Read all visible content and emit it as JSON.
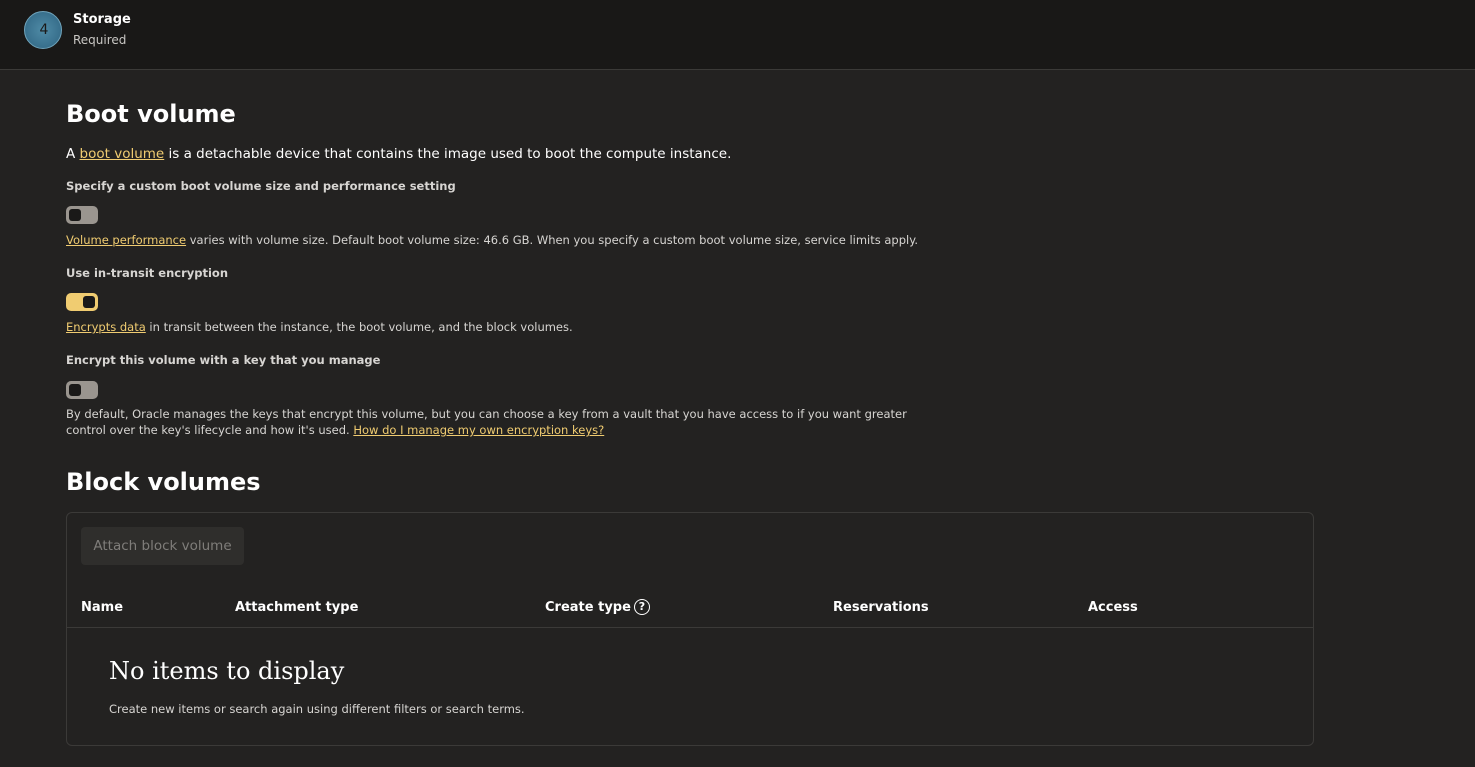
{
  "step": {
    "number": "4",
    "title": "Storage",
    "subtitle": "Required"
  },
  "boot_volume": {
    "heading": "Boot volume",
    "intro_prefix": "A ",
    "intro_link": "boot volume",
    "intro_suffix": " is a detachable device that contains the image used to boot the compute instance.",
    "custom_size": {
      "label": "Specify a custom boot volume size and performance setting",
      "enabled": false,
      "help_link": "Volume performance",
      "help_suffix": " varies with volume size. Default boot volume size: 46.6 GB. When you specify a custom boot volume size, service limits apply."
    },
    "in_transit": {
      "label": "Use in-transit encryption",
      "enabled": true,
      "help_link": "Encrypts data",
      "help_suffix": " in transit between the instance, the boot volume, and the block volumes."
    },
    "own_key": {
      "label": "Encrypt this volume with a key that you manage",
      "enabled": false,
      "help_line1": "By default, Oracle manages the keys that encrypt this volume, but you can choose a key from a vault that you have access to if you want greater",
      "help_line2_prefix": "control over the key's lifecycle and how it's used. ",
      "help_link": "How do I manage my own encryption keys?"
    }
  },
  "block_volumes": {
    "heading": "Block volumes",
    "attach_button": "Attach block volume",
    "columns": [
      "Name",
      "Attachment type",
      "Create type",
      "Reservations",
      "Access"
    ],
    "help_icon": "question-circle-icon",
    "empty_title": "No items to display",
    "empty_sub": "Create new items or search again using different filters or search terms."
  },
  "colors": {
    "accent": "#f0cc71",
    "background": "#232221",
    "header_background": "#191817"
  }
}
